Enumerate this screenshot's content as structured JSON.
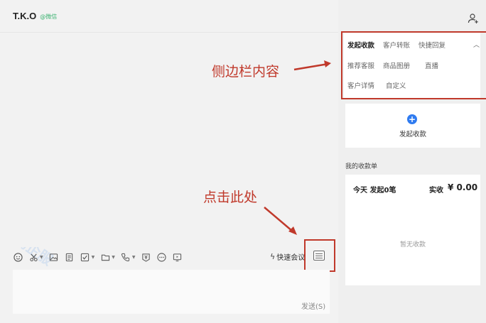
{
  "chat": {
    "contact_name": "T.K.O",
    "contact_tag": "@微信",
    "quick_meeting": "快速会议",
    "send_label": "发送(S)"
  },
  "sidebar": {
    "tabs": [
      "发起收款",
      "客户转账",
      "快捷回复",
      "推荐客服",
      "商品图册",
      "直播",
      "客户详情",
      "自定义"
    ],
    "payment_button": "发起收款",
    "orders_title": "我的收款单",
    "today_label": "今天 发起0笔",
    "received_label": "实收",
    "amount": "¥ 0.00",
    "empty_label": "暂无收款"
  },
  "annotations": {
    "sidebar_note": "侧边栏内容",
    "click_note": "点击此处"
  },
  "watermark_text": "语鹦企服",
  "colors": {
    "annotation": "#c0392b",
    "accent_blue": "#2f7bf0",
    "tag_green": "#3cb371"
  },
  "icons": [
    "emoji-icon",
    "scissors-icon",
    "image-icon",
    "document-icon",
    "checkbox-icon",
    "folder-icon",
    "phone-icon",
    "payment-icon",
    "more-icon",
    "screen-share-icon",
    "sidebar-toggle-icon",
    "add-contact-icon",
    "chevron-up-icon",
    "plus-circle-icon",
    "lightning-icon"
  ]
}
